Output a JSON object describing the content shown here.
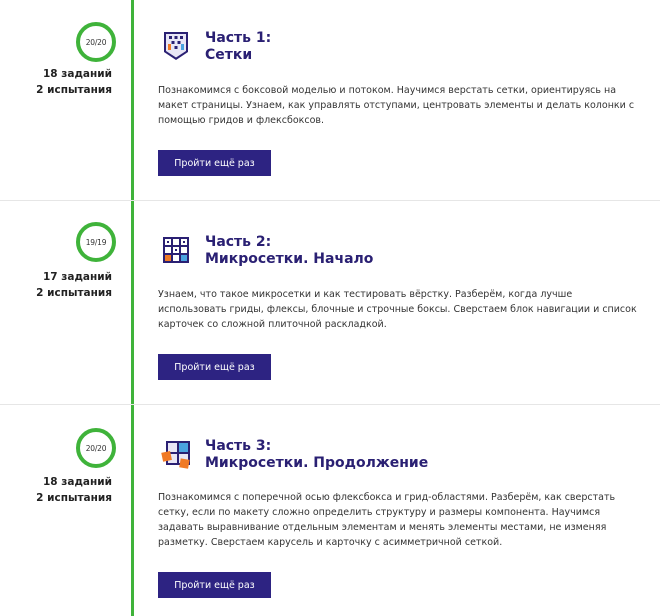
{
  "colors": {
    "timeline_green": "#3fb33a",
    "title_purple": "#2a2073",
    "button_purple": "#2d2382",
    "divider": "#e6e6e6"
  },
  "chapters": [
    {
      "progress": "20/20",
      "tasks": "18 заданий",
      "trials": "2 испытания",
      "title_line1": "Часть 1:",
      "title_line2": "Сетки",
      "description": "Познакомимся с боксовой моделью и потоком. Научимся верстать сетки, ориентируясь на макет страницы. Узнаем, как управлять отступами, центровать элементы и делать колонки с помощью гридов и флексбоксов.",
      "button_label": "Пройти ещё раз",
      "icon": "grid-chip-icon"
    },
    {
      "progress": "19/19",
      "tasks": "17 заданий",
      "trials": "2 испытания",
      "title_line1": "Часть 2:",
      "title_line2": "Микросетки. Начало",
      "description": "Узнаем, что такое микросетки и как тестировать вёрстку. Разберём, когда лучше использовать гриды, флексы, блочные и строчные боксы. Сверстаем блок навигации и список карточек со сложной плиточной раскладкой.",
      "button_label": "Пройти ещё раз",
      "icon": "numbered-grid-icon"
    },
    {
      "progress": "20/20",
      "tasks": "18 заданий",
      "trials": "2 испытания",
      "title_line1": "Часть 3:",
      "title_line2": "Микросетки. Продолжение",
      "description": "Познакомимся с поперечной осью флексбокса и грид-областями. Разберём, как сверстать сетку, если по макету сложно определить структуру и размеры компонента. Научимся задавать выравнивание отдельным элементам и менять элементы местами, не изменяя разметку. Сверстаем карусель и карточку с асимметричной сеткой.",
      "button_label": "Пройти ещё раз",
      "icon": "puzzle-grid-icon"
    }
  ]
}
